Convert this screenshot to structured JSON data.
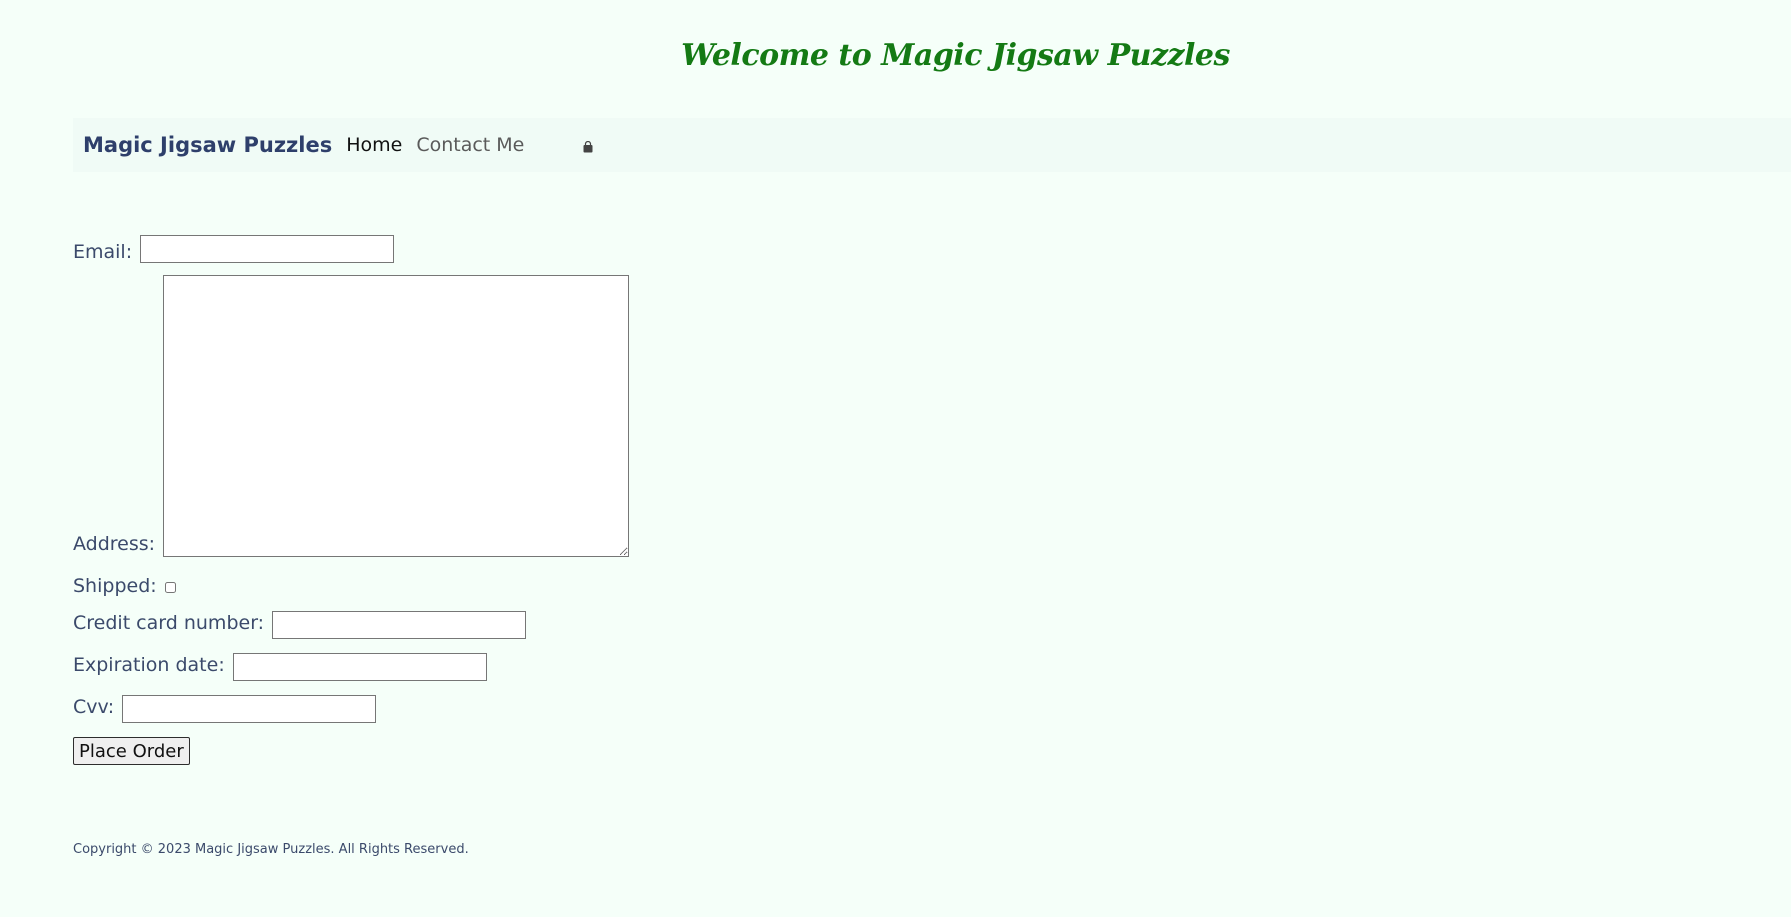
{
  "header": {
    "welcome": "Welcome to Magic Jigsaw Puzzles"
  },
  "nav": {
    "brand": "Magic Jigsaw Puzzles",
    "links": [
      {
        "label": "Home"
      },
      {
        "label": "Contact Me"
      }
    ],
    "cart_icon": "shopping-bag-icon"
  },
  "form": {
    "email_label": "Email:",
    "email_value": "",
    "address_label": "Address:",
    "address_value": "",
    "shipped_label": "Shipped:",
    "shipped_checked": false,
    "cc_label": "Credit card number:",
    "cc_value": "",
    "exp_label": "Expiration date:",
    "exp_value": "",
    "cvv_label": "Cvv:",
    "cvv_value": "",
    "submit_label": "Place Order"
  },
  "footer": {
    "copyright": "Copyright © 2023 Magic Jigsaw Puzzles. All Rights Reserved."
  },
  "colors": {
    "background": "#f5fff9",
    "welcome_text": "#147a14",
    "brand_text": "#2e3f6b",
    "body_text": "#3b4a6b"
  }
}
